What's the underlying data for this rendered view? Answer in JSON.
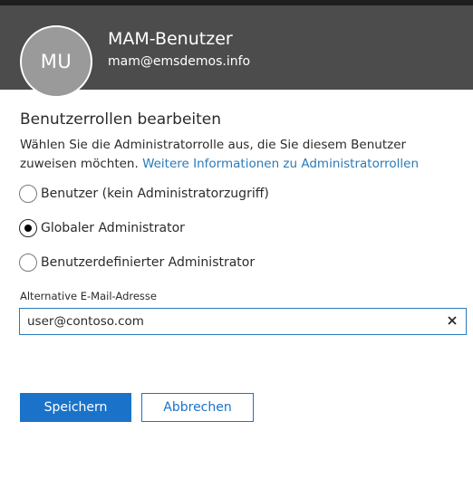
{
  "header": {
    "avatar_initials": "MU",
    "user_name": "MAM-Benutzer",
    "user_email": "mam@emsdemos.info",
    "background_color": "#4c4c4c"
  },
  "section": {
    "title": "Benutzerrollen bearbeiten",
    "description": "Wählen Sie die Administratorrolle aus, die Sie diesem Benutzer zuweisen möchten.",
    "link_text": "Weitere Informationen zu Administratorrollen"
  },
  "roles": {
    "selected": "Globaler Administrator",
    "options": [
      {
        "label": "Benutzer (kein Administratorzugriff)",
        "checked": false
      },
      {
        "label": "Globaler Administrator",
        "checked": true
      },
      {
        "label": "Benutzerdefinierter Administrator",
        "checked": false
      }
    ]
  },
  "alternate_email": {
    "label": "Alternative E-Mail-Adresse",
    "value": "user@contoso.com",
    "clear_icon": "close-icon"
  },
  "actions": {
    "save_label": "Speichern",
    "cancel_label": "Abbrechen",
    "accent_color": "#1a73c9"
  }
}
